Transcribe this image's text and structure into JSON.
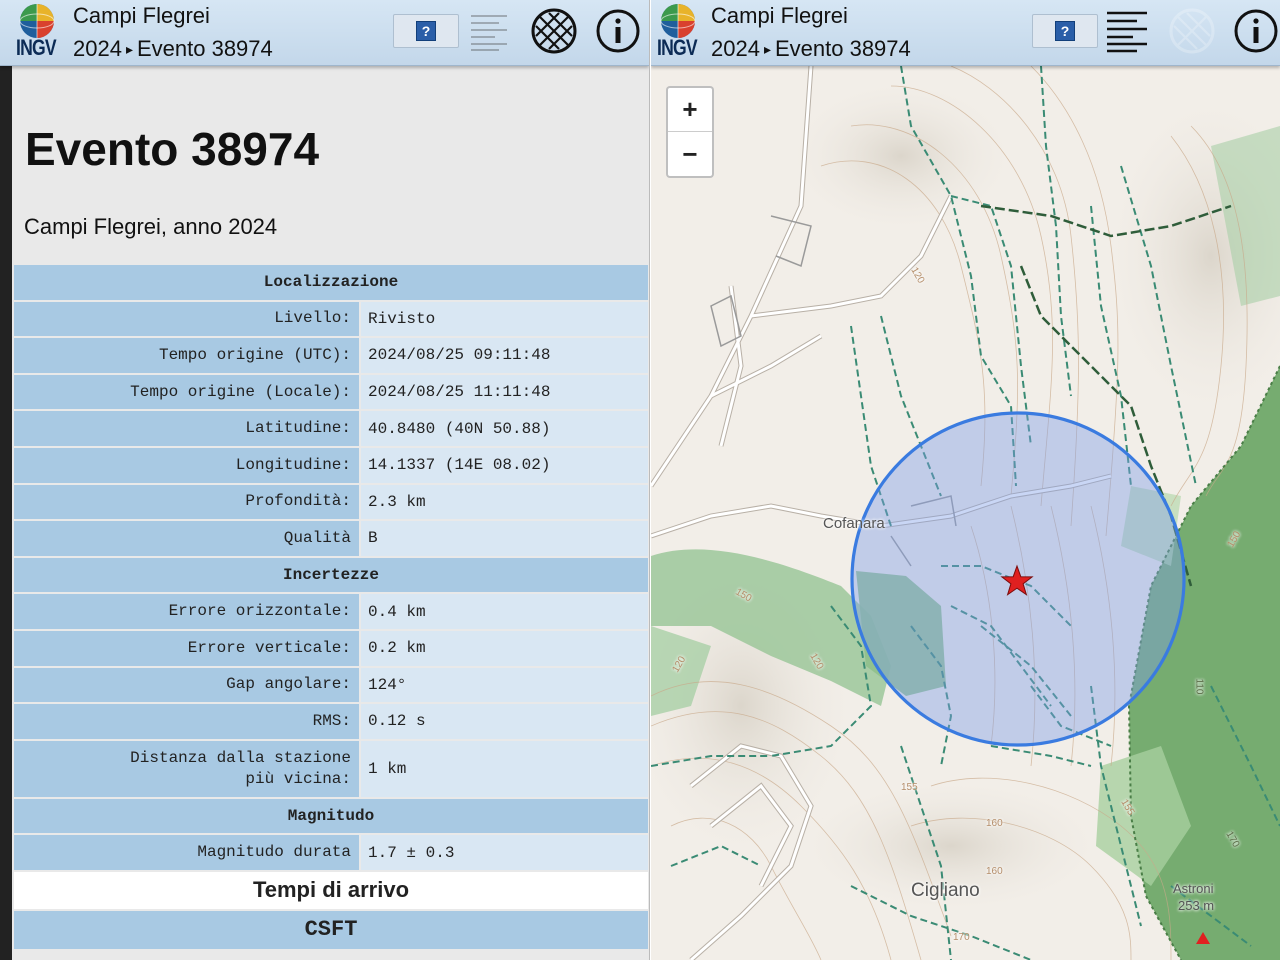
{
  "app": {
    "logo_text": "INGV",
    "title": "Campi Flegrei",
    "crumb_year": "2024",
    "crumb_arrow": "▸",
    "crumb_event": "Evento 38974",
    "help_label": "?"
  },
  "event": {
    "heading": "Evento 38974",
    "subtitle": "Campi Flegrei, anno 2024"
  },
  "table": {
    "localizzazione": "Localizzazione",
    "rows_loc": [
      {
        "key": "Livello:",
        "val": "Rivisto"
      },
      {
        "key": "Tempo origine (UTC):",
        "val": "2024/08/25 09:11:48"
      },
      {
        "key": "Tempo origine (Locale):",
        "val": "2024/08/25 11:11:48"
      },
      {
        "key": "Latitudine:",
        "val": "40.8480 (40N 50.88)"
      },
      {
        "key": "Longitudine:",
        "val": "14.1337 (14E 08.02)"
      },
      {
        "key": "Profondità:",
        "val": "2.3 km"
      },
      {
        "key": "Qualità",
        "val": "B"
      }
    ],
    "incertezze": "Incertezze",
    "rows_inc": [
      {
        "key": "Errore orizzontale:",
        "val": "0.4 km"
      },
      {
        "key": "Errore verticale:",
        "val": "0.2 km"
      },
      {
        "key": "Gap angolare:",
        "val": "124°"
      },
      {
        "key": "RMS:",
        "val": "0.12 s"
      }
    ],
    "distanza_key_1": "Distanza dalla stazione",
    "distanza_key_2": "più vicina:",
    "distanza_val": "1 km",
    "magnitudo": "Magnitudo",
    "mag_key": "Magnitudo durata",
    "mag_val": "1.7 ± 0.3",
    "tempi": "Tempi di arrivo",
    "csft": "CSFT"
  },
  "map": {
    "zoom_in": "+",
    "zoom_out": "−",
    "labels": {
      "cofanara": "Cofanara",
      "cigliano": "Cigliano",
      "astroni": "Astroni",
      "astroni_elev": "253 m"
    },
    "contour_labels": [
      "150",
      "120",
      "120",
      "150",
      "155",
      "160",
      "170",
      "110",
      "120",
      "155",
      "160",
      "170"
    ],
    "colors": {
      "circle": "#3a7be0",
      "epicenter": "#e02020",
      "park": "#7fb47a"
    }
  },
  "icons": {
    "help": "help-icon",
    "list": "list-icon",
    "map": "map-globe-icon",
    "info": "info-icon"
  }
}
